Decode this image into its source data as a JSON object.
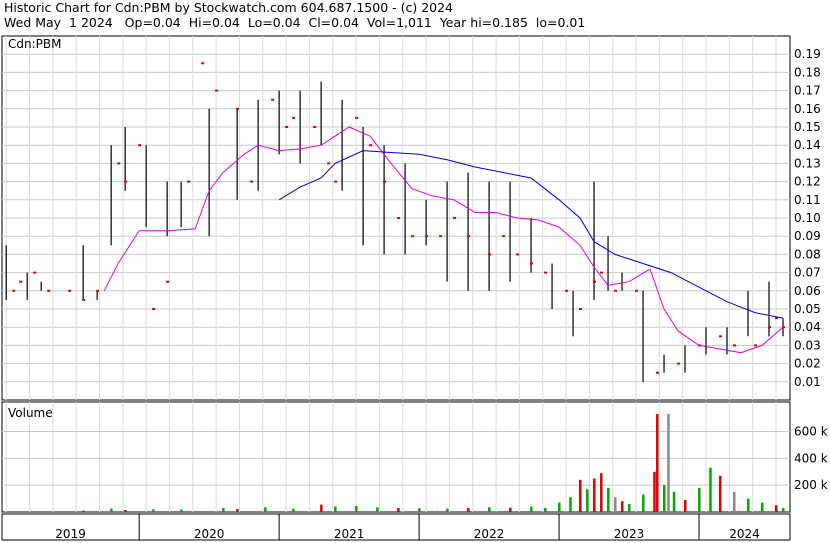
{
  "header": {
    "line1": "Historic Chart for Cdn:PBM by Stockwatch.com 604.687.1500 - (c) 2024",
    "line2": "Wed May  1 2024   Op=0.04  Hi=0.04  Lo=0.04  Cl=0.04  Vol=1,011  Year hi=0.185  lo=0.01"
  },
  "chart_data": [
    {
      "type": "line",
      "panel_label": "Cdn:PBM",
      "ylim": [
        0,
        0.2
      ],
      "y_ticks": [
        "0.19",
        "0.18",
        "0.17",
        "0.16",
        "0.15",
        "0.14",
        "0.13",
        "0.12",
        "0.11",
        "0.10",
        "0.09",
        "0.08",
        "0.07",
        "0.06",
        "0.05",
        "0.04",
        "0.03",
        "0.02",
        "0.01"
      ],
      "x_ticks": [
        "2019",
        "2020",
        "2021",
        "2022",
        "2023",
        "2024"
      ],
      "grid": true,
      "colors": {
        "price": "#000000",
        "close_tick": "#dd0000",
        "ma_short": "#dd00dd",
        "ma_long": "#0000cc"
      },
      "series": [
        {
          "role": "price-range",
          "x": [
            2018.75,
            2018.9,
            2019.0,
            2019.3,
            2019.4,
            2019.5,
            2019.6,
            2019.75,
            2019.9,
            2020.0,
            2020.2,
            2020.4,
            2020.55,
            2020.7,
            2020.85,
            2021.0,
            2021.15,
            2021.3,
            2021.45,
            2021.6,
            2021.75,
            2021.9,
            2022.05,
            2022.2,
            2022.35,
            2022.5,
            2022.65,
            2022.8,
            2022.95,
            2023.05,
            2023.15,
            2023.3,
            2023.45,
            2023.6,
            2023.75,
            2023.9,
            2024.05,
            2024.2,
            2024.3
          ],
          "high": [
            0.085,
            0.07,
            0.065,
            0.085,
            0.06,
            0.14,
            0.15,
            0.14,
            0.12,
            0.12,
            0.16,
            0.16,
            0.165,
            0.17,
            0.17,
            0.175,
            0.165,
            0.15,
            0.14,
            0.13,
            0.11,
            0.12,
            0.125,
            0.12,
            0.12,
            0.1,
            0.075,
            0.06,
            0.12,
            0.09,
            0.07,
            0.06,
            0.025,
            0.03,
            0.04,
            0.04,
            0.06,
            0.065,
            0.045
          ],
          "low": [
            0.055,
            0.055,
            0.06,
            0.055,
            0.055,
            0.085,
            0.115,
            0.095,
            0.09,
            0.095,
            0.09,
            0.11,
            0.115,
            0.135,
            0.13,
            0.14,
            0.115,
            0.085,
            0.08,
            0.08,
            0.085,
            0.065,
            0.06,
            0.06,
            0.065,
            0.07,
            0.05,
            0.035,
            0.055,
            0.06,
            0.06,
            0.01,
            0.015,
            0.015,
            0.025,
            0.025,
            0.035,
            0.035,
            0.035
          ]
        },
        {
          "name": "MA short",
          "x": [
            2019.45,
            2019.55,
            2019.7,
            2019.9,
            2020.1,
            2020.2,
            2020.3,
            2020.45,
            2020.55,
            2020.7,
            2020.85,
            2021.0,
            2021.1,
            2021.2,
            2021.35,
            2021.5,
            2021.65,
            2021.8,
            2021.95,
            2022.1,
            2022.25,
            2022.4,
            2022.55,
            2022.7,
            2022.85,
            2022.95,
            2023.05,
            2023.2,
            2023.35,
            2023.45,
            2023.55,
            2023.7,
            2023.85,
            2024.0,
            2024.15,
            2024.3
          ],
          "values": [
            0.06,
            0.075,
            0.093,
            0.093,
            0.094,
            0.115,
            0.125,
            0.135,
            0.14,
            0.137,
            0.138,
            0.14,
            0.145,
            0.15,
            0.145,
            0.13,
            0.116,
            0.112,
            0.11,
            0.103,
            0.103,
            0.1,
            0.099,
            0.095,
            0.085,
            0.073,
            0.063,
            0.065,
            0.072,
            0.05,
            0.038,
            0.03,
            0.028,
            0.026,
            0.03,
            0.04
          ]
        },
        {
          "name": "MA long",
          "x": [
            2020.7,
            2020.85,
            2021.0,
            2021.1,
            2021.3,
            2021.5,
            2021.7,
            2021.9,
            2022.1,
            2022.3,
            2022.5,
            2022.7,
            2022.85,
            2022.95,
            2023.1,
            2023.3,
            2023.5,
            2023.7,
            2023.9,
            2024.1,
            2024.3
          ],
          "values": [
            0.11,
            0.117,
            0.122,
            0.13,
            0.137,
            0.136,
            0.135,
            0.132,
            0.128,
            0.125,
            0.122,
            0.11,
            0.1,
            0.087,
            0.08,
            0.075,
            0.07,
            0.062,
            0.054,
            0.048,
            0.045
          ]
        },
        {
          "role": "close-ticks",
          "x": [
            2018.8,
            2018.85,
            2018.95,
            2019.05,
            2019.2,
            2019.3,
            2019.4,
            2019.55,
            2019.6,
            2019.7,
            2019.8,
            2019.9,
            2020.05,
            2020.15,
            2020.25,
            2020.4,
            2020.5,
            2020.65,
            2020.75,
            2020.8,
            2020.95,
            2021.05,
            2021.1,
            2021.25,
            2021.35,
            2021.45,
            2021.55,
            2021.65,
            2021.75,
            2021.85,
            2021.95,
            2022.05,
            2022.2,
            2022.3,
            2022.4,
            2022.5,
            2022.6,
            2022.75,
            2022.85,
            2022.95,
            2023.0,
            2023.1,
            2023.25,
            2023.4,
            2023.55,
            2023.7,
            2023.85,
            2023.95,
            2024.1,
            2024.2,
            2024.25,
            2024.3
          ],
          "values": [
            0.06,
            0.065,
            0.07,
            0.06,
            0.06,
            0.055,
            0.06,
            0.13,
            0.12,
            0.14,
            0.05,
            0.065,
            0.12,
            0.185,
            0.17,
            0.16,
            0.12,
            0.165,
            0.15,
            0.155,
            0.15,
            0.13,
            0.12,
            0.155,
            0.14,
            0.12,
            0.1,
            0.09,
            0.09,
            0.09,
            0.1,
            0.09,
            0.08,
            0.09,
            0.08,
            0.075,
            0.07,
            0.06,
            0.05,
            0.065,
            0.07,
            0.06,
            0.06,
            0.015,
            0.02,
            0.03,
            0.035,
            0.03,
            0.03,
            0.04,
            0.045,
            0.04
          ]
        }
      ]
    },
    {
      "type": "bar",
      "panel_label": "Volume",
      "ylim": [
        0,
        820
      ],
      "y_ticks": [
        "600 k",
        "400 k",
        "200 k"
      ],
      "colors": {
        "up": "#00aa00",
        "down": "#dd0000",
        "flat": "#888888"
      },
      "bars": [
        [
          2019.3,
          10,
          "down"
        ],
        [
          2019.5,
          25,
          "up"
        ],
        [
          2019.6,
          15,
          "down"
        ],
        [
          2019.8,
          20,
          "up"
        ],
        [
          2020.0,
          18,
          "up"
        ],
        [
          2020.3,
          30,
          "up"
        ],
        [
          2020.4,
          22,
          "down"
        ],
        [
          2020.6,
          35,
          "up"
        ],
        [
          2020.8,
          25,
          "up"
        ],
        [
          2021.0,
          55,
          "down"
        ],
        [
          2021.1,
          40,
          "up"
        ],
        [
          2021.25,
          45,
          "up"
        ],
        [
          2021.4,
          35,
          "up"
        ],
        [
          2021.55,
          30,
          "down"
        ],
        [
          2021.7,
          28,
          "up"
        ],
        [
          2021.9,
          25,
          "up"
        ],
        [
          2022.05,
          30,
          "down"
        ],
        [
          2022.2,
          35,
          "up"
        ],
        [
          2022.35,
          32,
          "down"
        ],
        [
          2022.5,
          40,
          "up"
        ],
        [
          2022.6,
          30,
          "up"
        ],
        [
          2022.7,
          70,
          "up"
        ],
        [
          2022.78,
          110,
          "up"
        ],
        [
          2022.85,
          240,
          "down"
        ],
        [
          2022.9,
          170,
          "up"
        ],
        [
          2022.95,
          250,
          "down"
        ],
        [
          2023.0,
          290,
          "down"
        ],
        [
          2023.05,
          180,
          "up"
        ],
        [
          2023.1,
          110,
          "flat"
        ],
        [
          2023.15,
          80,
          "down"
        ],
        [
          2023.2,
          60,
          "up"
        ],
        [
          2023.3,
          130,
          "up"
        ],
        [
          2023.38,
          300,
          "down"
        ],
        [
          2023.4,
          730,
          "down"
        ],
        [
          2023.45,
          200,
          "up"
        ],
        [
          2023.48,
          730,
          "flat"
        ],
        [
          2023.52,
          150,
          "up"
        ],
        [
          2023.6,
          90,
          "down"
        ],
        [
          2023.7,
          180,
          "up"
        ],
        [
          2023.78,
          330,
          "up"
        ],
        [
          2023.85,
          270,
          "down"
        ],
        [
          2023.95,
          150,
          "flat"
        ],
        [
          2024.05,
          100,
          "up"
        ],
        [
          2024.15,
          70,
          "up"
        ],
        [
          2024.25,
          50,
          "down"
        ],
        [
          2024.3,
          30,
          "up"
        ]
      ]
    }
  ]
}
